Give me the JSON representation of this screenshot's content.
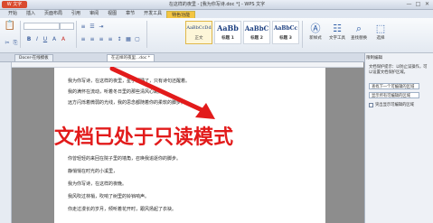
{
  "app": {
    "logo_label": "W 文字",
    "window_title": "在这样的夜里 - [我为你写诗.doc *] - WPS 文字",
    "controls": [
      "—",
      "□",
      "✕"
    ]
  },
  "menu": {
    "tabs": [
      {
        "label": "开始",
        "state": "normal"
      },
      {
        "label": "插入",
        "state": "normal"
      },
      {
        "label": "页面布局",
        "state": "normal"
      },
      {
        "label": "引用",
        "state": "normal"
      },
      {
        "label": "审阅",
        "state": "normal"
      },
      {
        "label": "视图",
        "state": "normal"
      },
      {
        "label": "章节",
        "state": "normal"
      },
      {
        "label": "开发工具",
        "state": "normal"
      },
      {
        "label": "特色功能",
        "state": "active"
      }
    ]
  },
  "ribbon": {
    "styles": [
      {
        "sample": "AaBbCcDd",
        "name": "正文",
        "selected": true
      },
      {
        "sample": "AaBb",
        "name": "标题 1",
        "selected": false
      },
      {
        "sample": "AaBbC",
        "name": "标题 2",
        "selected": false
      },
      {
        "sample": "AaBbCc",
        "name": "标题 3",
        "selected": false
      }
    ],
    "tools": [
      {
        "icon": "new-style-icon",
        "label": "新样式"
      },
      {
        "icon": "text-tools-icon",
        "label": "文字工具"
      },
      {
        "icon": "find-replace-icon",
        "label": "查找替换"
      },
      {
        "icon": "select-icon",
        "label": "选择"
      }
    ]
  },
  "doc_tabs": [
    {
      "label": "Docer-在线模板",
      "active": false
    },
    {
      "label": "在这样的夜里...doc *",
      "active": true
    }
  ],
  "document": {
    "lines": [
      "我为你写诗，在这样的夜里，星子都睡了，只有诗句还醒着。",
      "我的满怀在流动，听着冬日里的那些清风心跳。",
      "远方闪烁着微弱的光线，我的思念都随着你的柔软的脚步。",
      "",
      "",
      "你曾轻轻的来回在院子里的墙角，召唤我追逐你的脚步。",
      "静悄悄在时光的小溪里，",
      "我为你写诗，在这样的夜晚。",
      "我风吹过林梢，吹响了树里的铃铛响声。",
      "你走过漫长的岁月，倾听着花开时，跟风扬起了衣袂。"
    ],
    "overlay": "文档已处于只读模式"
  },
  "right_pane": {
    "title": "限制编辑",
    "intro": "文档保护提示：以防止误操作，可以设置文档保护区域。",
    "buttons": [
      "查找下一个可编辑的区域",
      "显示所有可编辑的区域"
    ],
    "checkbox_label": "突出显示可编辑的区域"
  }
}
